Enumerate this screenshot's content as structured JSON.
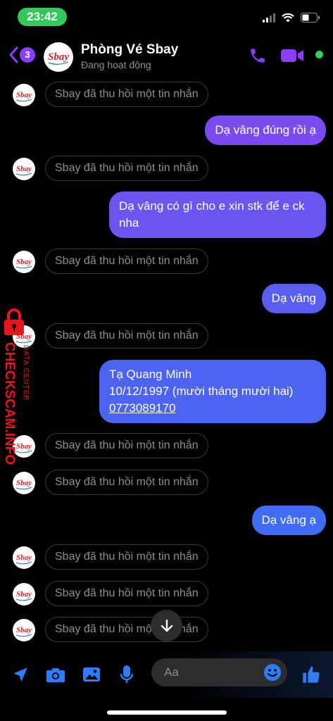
{
  "status_bar": {
    "time": "23:42"
  },
  "header": {
    "back_badge": "3",
    "name": "Phòng Vé Sbay",
    "status": "Đang hoạt động",
    "avatar_logo_text": "Sbay"
  },
  "messages": {
    "recall_text": "Sbay đã thu hồi một tin nhắn",
    "out_1": "Dạ vâng đúng rồi ạ",
    "out_2": "Dạ vâng có gì cho e xin stk để e ck nha",
    "out_3": "Dạ vâng",
    "out_4_line1": "Tạ Quang Minh",
    "out_4_line2": "10/12/1997 (mười tháng mười hai)",
    "out_4_phone": "0773089170",
    "out_5": "Dạ vâng ạ"
  },
  "watermark": {
    "main": "CHECKSCAM.INFO",
    "sub": "DATA CENTER"
  },
  "composer": {
    "placeholder": "Aa"
  },
  "colors": {
    "accent": "#8b3dff",
    "online": "#30d158",
    "time_pill": "#34c759",
    "watermark": "#e8151b",
    "composer_icon": "#2f7cf6"
  }
}
